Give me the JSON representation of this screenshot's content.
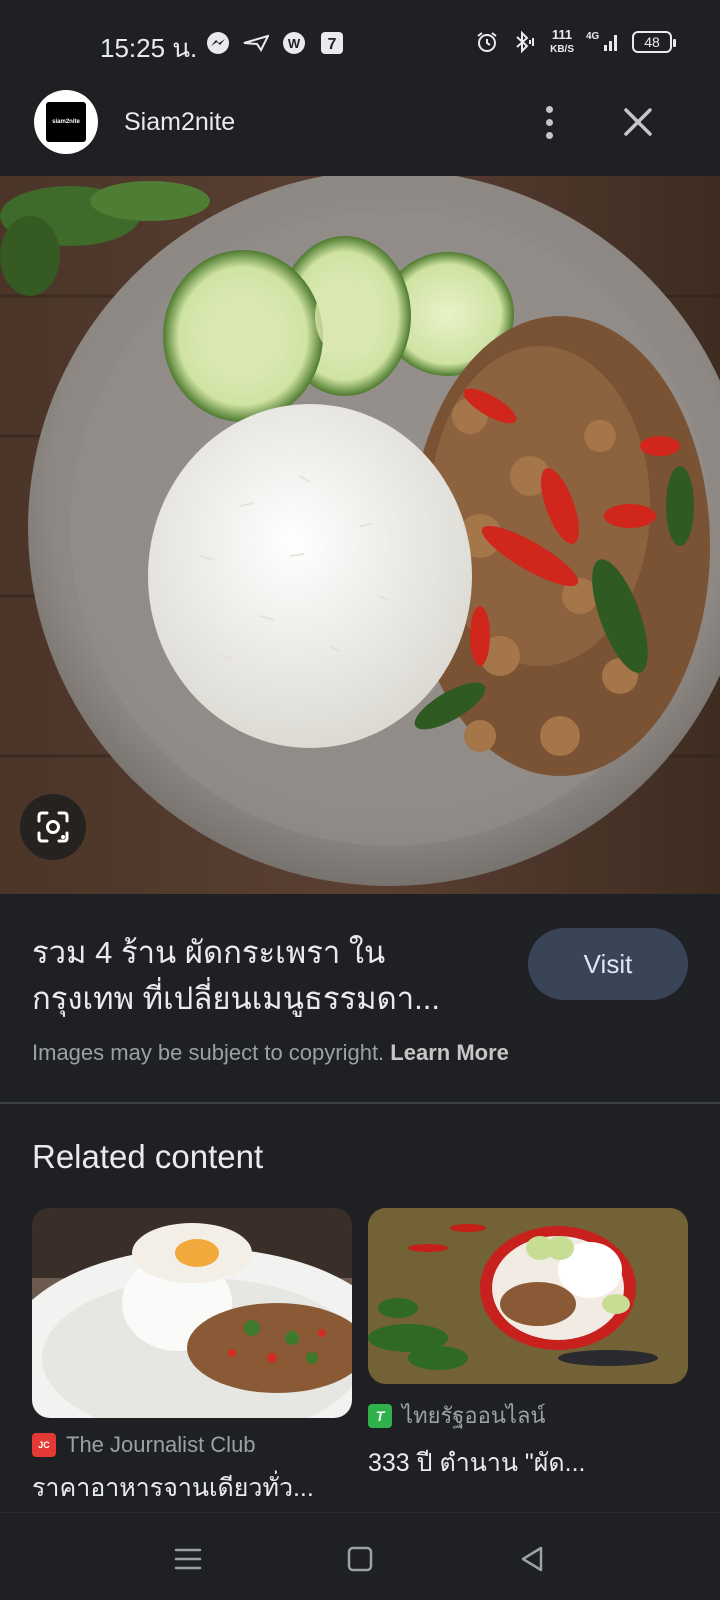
{
  "status_bar": {
    "time": "15:25 น.",
    "speed_value": "111",
    "speed_unit": "KB/S",
    "network": "4G",
    "battery": "48",
    "left_icons": [
      "messenger-icon",
      "paper-plane-icon",
      "w-app-icon",
      "seven-eleven-icon"
    ],
    "right_icons": [
      "alarm-icon",
      "bluetooth-icon",
      "signal-icon"
    ]
  },
  "header": {
    "site_name": "Siam2nite",
    "logo_text": "siam2nite"
  },
  "result": {
    "title_line1": "รวม 4 ร้าน ผัดกระเพรา ใน",
    "title_line2": "กรุงเทพ ที่เปลี่ยนเมนูธรรมดา...",
    "visit_label": "Visit",
    "copyright_text": "Images may be subject to copyright.",
    "learn_more": "Learn More"
  },
  "related": {
    "heading": "Related content",
    "cards": [
      {
        "source": "The Journalist Club",
        "title": "ราคาอาหารจานเดียวทั่ว...",
        "favicon_color": "#e53935",
        "favicon_text": "JC"
      },
      {
        "source": "ไทยรัฐออนไลน์",
        "title": "333 ปี ตำนาน \"ผัด...",
        "favicon_color": "#2fb24c",
        "favicon_text": "T"
      }
    ]
  },
  "colors": {
    "background": "#1f2023",
    "visit_button": "#394457",
    "divider": "#3c4043"
  },
  "nav": {
    "icons": [
      "menu-icon",
      "home-square-icon",
      "back-triangle-icon"
    ]
  }
}
